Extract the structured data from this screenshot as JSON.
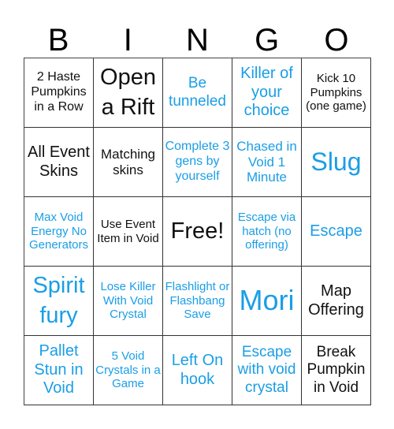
{
  "header": {
    "letters": [
      "B",
      "I",
      "N",
      "G",
      "O"
    ]
  },
  "colors": {
    "blue": "#1a9ee6",
    "black": "#111111"
  },
  "board": {
    "cells": [
      {
        "text": "2 Haste Pumpkins in a Row",
        "color": "black",
        "size": "s16"
      },
      {
        "text": "Open a Rift",
        "color": "black",
        "size": "s28"
      },
      {
        "text": "Be tunneled",
        "color": "blue",
        "size": "s19"
      },
      {
        "text": "Killer of your choice",
        "color": "blue",
        "size": "s20"
      },
      {
        "text": "Kick 10 Pumpkins (one game)",
        "color": "black",
        "size": "s14"
      },
      {
        "text": "All Event Skins",
        "color": "black",
        "size": "s20"
      },
      {
        "text": "Matching skins",
        "color": "black",
        "size": "s17"
      },
      {
        "text": "Complete 3 gens by yourself",
        "color": "blue",
        "size": "s16"
      },
      {
        "text": "Chased in Void 1 Minute",
        "color": "blue",
        "size": "s17"
      },
      {
        "text": "Slug",
        "color": "blue",
        "size": "s32"
      },
      {
        "text": "Max Void Energy No Generators",
        "color": "blue",
        "size": "s14"
      },
      {
        "text": "Use Event Item in Void",
        "color": "black",
        "size": "s14"
      },
      {
        "text": "Free!",
        "color": "black",
        "size": "s28"
      },
      {
        "text": "Escape via hatch (no offering)",
        "color": "blue",
        "size": "s14"
      },
      {
        "text": "Escape",
        "color": "blue",
        "size": "s20"
      },
      {
        "text": "Spirit fury",
        "color": "blue",
        "size": "s28"
      },
      {
        "text": "Lose Killer With Void Crystal",
        "color": "blue",
        "size": "s14"
      },
      {
        "text": "Flashlight or Flashbang Save",
        "color": "blue",
        "size": "s14"
      },
      {
        "text": "Mori",
        "color": "blue",
        "size": "s36"
      },
      {
        "text": "Map Offering",
        "color": "black",
        "size": "s20"
      },
      {
        "text": "Pallet Stun in Void",
        "color": "blue",
        "size": "s20"
      },
      {
        "text": "5 Void Crystals in a Game",
        "color": "blue",
        "size": "s14"
      },
      {
        "text": "Left On hook",
        "color": "blue",
        "size": "s20"
      },
      {
        "text": "Escape with void crystal",
        "color": "blue",
        "size": "s19"
      },
      {
        "text": "Break Pumpkin in Void",
        "color": "black",
        "size": "s19"
      }
    ]
  }
}
